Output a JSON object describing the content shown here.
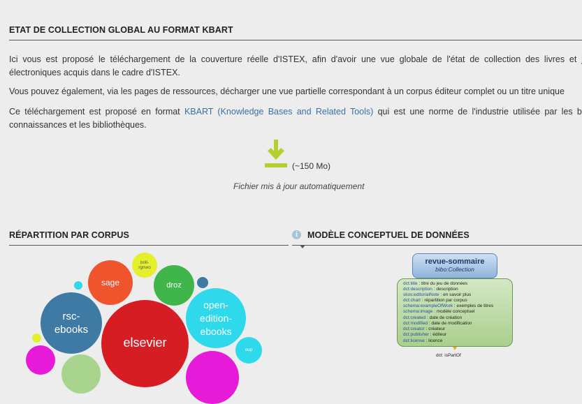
{
  "kbart": {
    "title": "ETAT DE COLLECTION GLOBAL AU FORMAT KBART",
    "p1": "Ici vous est proposé le téléchargement de la couverture réelle d'ISTEX, afin d'avoir une vue globale de l'état de collection des livres et jour électroniques acquis dans le cadre d'ISTEX.",
    "p2": "Vous pouvez également, via les pages de ressources, décharger une vue partielle correspondant à un corpus éditeur complet ou un titre unique",
    "p3_before": "Ce téléchargement est proposé en format ",
    "p3_link": "KBART (Knowledge Bases and Related Tools)",
    "p3_after": " qui est une norme de l'industrie utilisée par les base connaissances et les bibliothèques.",
    "download_icon": "download-arrow-icon",
    "download_size": "(~150 Mo)",
    "download_note": "Fichier mis à jour automatiquement",
    "accent_color": "#b5cf2f"
  },
  "corpus": {
    "title": "RÉPARTITION PAR CORPUS",
    "bubbles": [
      {
        "label": "sage",
        "color": "#f0542d"
      },
      {
        "label": "brill-rgnwo",
        "color": "#e6ef2c"
      },
      {
        "label": "droz",
        "color": "#3fb54a"
      },
      {
        "label": "rsc-ebooks",
        "color": "#3f7aa5"
      },
      {
        "label": "open-edition-ebooks",
        "color": "#2fd9ec"
      },
      {
        "label": "elsevier",
        "color": "#d61d24"
      },
      {
        "label": "oup",
        "color": "#2fd9ec"
      }
    ]
  },
  "model": {
    "info_icon": "info-icon",
    "title": "MODÈLE CONCEPTUEL DE DONNÉES",
    "class_name": "revue-sommaire",
    "class_type": "bibo:Collection",
    "props": [
      {
        "k": "dct:title",
        "v": " : titre du jeu de données"
      },
      {
        "k": "dct:description",
        "v": " : description"
      },
      {
        "k": "skos:editorialNote",
        "v": " : en savoir plus"
      },
      {
        "k": "dct:chart",
        "v": " : répartition par corpus"
      },
      {
        "k": "schema:exampleOfWork",
        "v": " : exemples de titres"
      },
      {
        "k": "schema:image",
        "v": " : modèle conceptuel"
      },
      {
        "k": "dct:created",
        "v": " : date de création"
      },
      {
        "k": "dct:modified",
        "v": " : date de modification"
      },
      {
        "k": "dct:creator",
        "v": " : créateur"
      },
      {
        "k": "dct:publisher",
        "v": " : éditeur"
      },
      {
        "k": "dct:license",
        "v": " : licence"
      }
    ],
    "relation": "dct: isPartOf"
  }
}
